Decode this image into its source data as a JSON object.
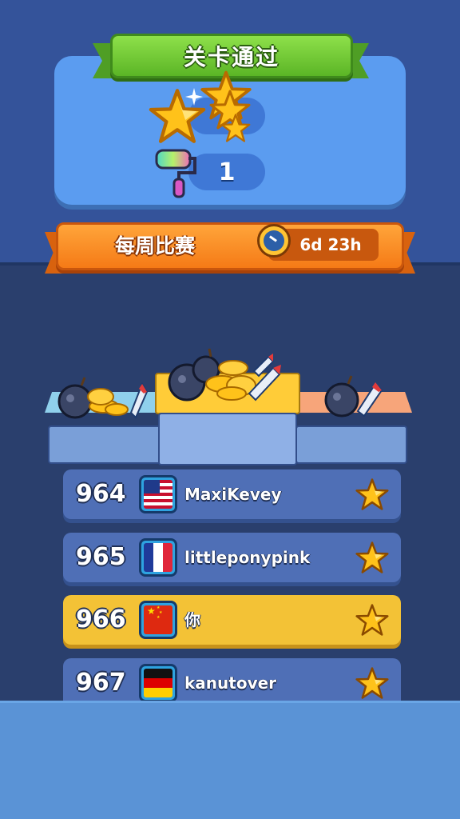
{
  "level_complete": {
    "title": "关卡通过",
    "stars_count": "",
    "roller_count": "1"
  },
  "weekly": {
    "title": "每周比赛",
    "time_left": "6d 23h"
  },
  "leaderboard": [
    {
      "rank": "964",
      "name": "MaxiKevey",
      "flag": "us-flag-icon",
      "highlight": false
    },
    {
      "rank": "965",
      "name": "littleponypink",
      "flag": "fr-flag-icon",
      "highlight": false
    },
    {
      "rank": "966",
      "name": "你",
      "flag": "cn-flag-icon",
      "highlight": true
    },
    {
      "rank": "967",
      "name": "kanutover",
      "flag": "de-flag-icon",
      "highlight": false
    }
  ],
  "colors": {
    "background": "#2a3f6d",
    "ribbon_green": "#6cc932",
    "banner_orange": "#f57a16",
    "row_blue": "#4f6fb6",
    "row_highlight": "#f3c236",
    "star_gold": "#ffc21a"
  }
}
